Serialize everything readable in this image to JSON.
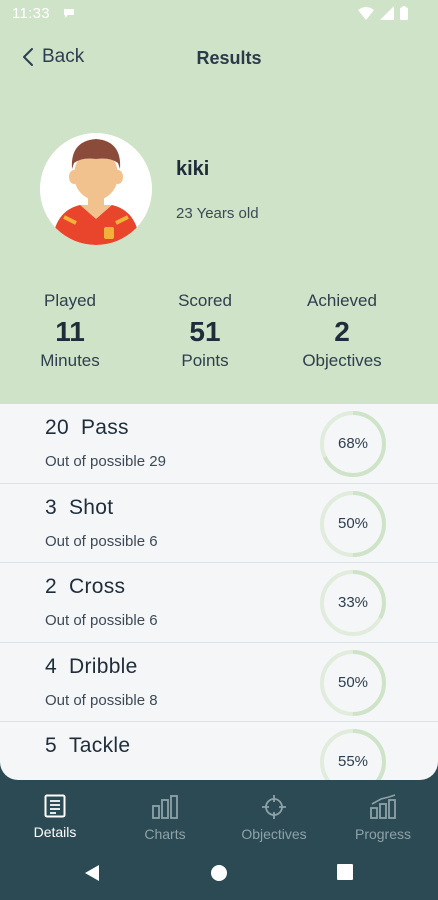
{
  "status_bar": {
    "time": "11:33"
  },
  "header": {
    "back_label": "Back",
    "title": "Results"
  },
  "player": {
    "name": "kiki",
    "age": "23 Years old"
  },
  "stats": [
    {
      "label": "Played",
      "value": "11",
      "unit": "Minutes"
    },
    {
      "label": "Scored",
      "value": "51",
      "unit": "Points"
    },
    {
      "label": "Achieved",
      "value": "2",
      "unit": "Objectives"
    }
  ],
  "results": [
    {
      "count": "20",
      "action": "Pass",
      "subtitle": "Out of possible 29",
      "percent_label": "68%",
      "fraction": 0.68
    },
    {
      "count": "3",
      "action": "Shot",
      "subtitle": "Out of possible 6",
      "percent_label": "50%",
      "fraction": 0.5
    },
    {
      "count": "2",
      "action": "Cross",
      "subtitle": "Out of possible 6",
      "percent_label": "33%",
      "fraction": 0.33
    },
    {
      "count": "4",
      "action": "Dribble",
      "subtitle": "Out of possible 8",
      "percent_label": "50%",
      "fraction": 0.5
    },
    {
      "count": "5",
      "action": "Tackle",
      "subtitle": "",
      "percent_label": "55%",
      "fraction": 0.55
    }
  ],
  "bottom_nav": [
    {
      "label": "Details",
      "icon": "document-icon",
      "active": true
    },
    {
      "label": "Charts",
      "icon": "bar-chart-icon",
      "active": false
    },
    {
      "label": "Objectives",
      "icon": "crosshair-icon",
      "active": false
    },
    {
      "label": "Progress",
      "icon": "progress-chart-icon",
      "active": false
    }
  ],
  "colors": {
    "header_bg": "#cfe3c8",
    "list_bg": "#f4f6f8",
    "nav_bg": "#2b4a53",
    "ring_track": "#e1ecdc",
    "ring_fill": "#cfe3c8"
  }
}
